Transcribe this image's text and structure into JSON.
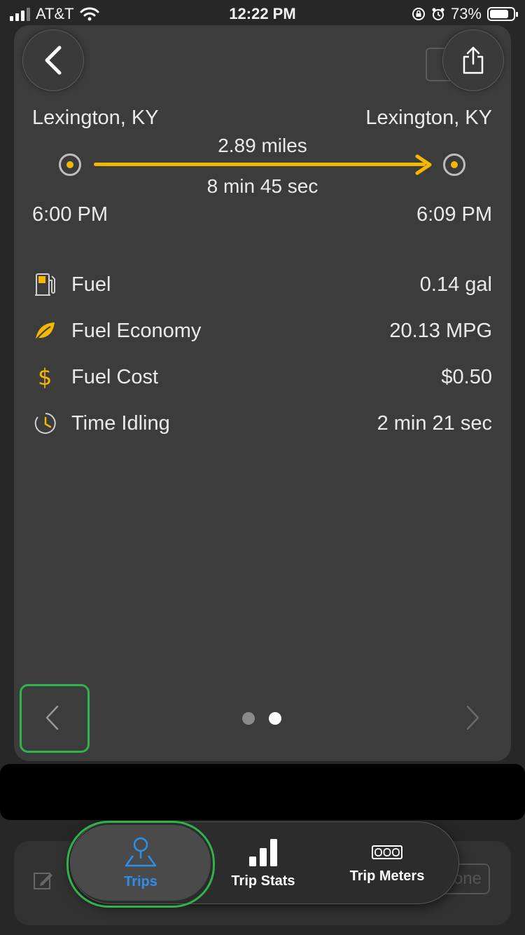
{
  "status_bar": {
    "carrier": "AT&T",
    "time": "12:22 PM",
    "battery": "73%"
  },
  "trip": {
    "start_location": "Lexington, KY",
    "end_location": "Lexington, KY",
    "distance": "2.89 miles",
    "duration": "8 min 45 sec",
    "start_time": "6:00 PM",
    "end_time": "6:09 PM"
  },
  "stats": [
    {
      "icon": "fuel-pump-icon",
      "label": "Fuel",
      "value": "0.14 gal"
    },
    {
      "icon": "leaf-icon",
      "label": "Fuel Economy",
      "value": "20.13 MPG"
    },
    {
      "icon": "dollar-icon",
      "label": "Fuel Cost",
      "value": "$0.50"
    },
    {
      "icon": "clock-icon",
      "label": "Time Idling",
      "value": "2 min 21 sec"
    }
  ],
  "pager": {
    "current": 2,
    "total": 2
  },
  "bottom": {
    "ghost_button": "one"
  },
  "tabs": [
    {
      "label": "Trips",
      "icon": "trips-pin-icon",
      "active": true
    },
    {
      "label": "Trip Stats",
      "icon": "bar-chart-icon",
      "active": false
    },
    {
      "label": "Trip Meters",
      "icon": "odometer-icon",
      "active": false
    }
  ],
  "colors": {
    "accent": "#f5b800",
    "active_tab": "#2e8fe8",
    "highlight": "#2fb34a",
    "card": "#3c3c3c",
    "background": "#272727"
  }
}
